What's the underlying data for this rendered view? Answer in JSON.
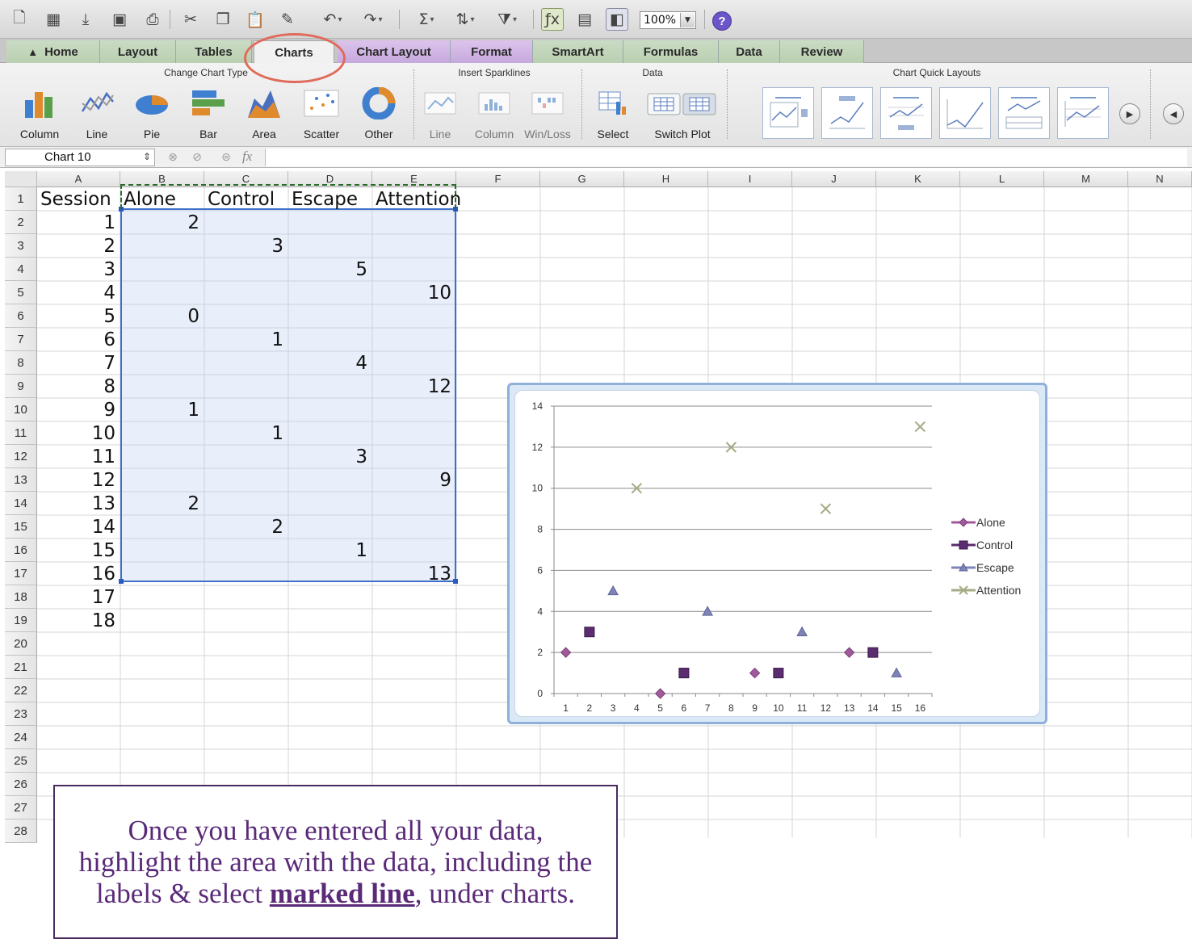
{
  "toolbar": {
    "zoom": "100%",
    "icons": [
      "new-icon",
      "gallery-icon",
      "open-icon",
      "save-icon",
      "print-icon",
      "cut-icon",
      "copy-icon",
      "paste-icon",
      "format-painter-icon",
      "undo-icon",
      "redo-icon",
      "autosum-icon",
      "sort-icon",
      "filter-icon",
      "function-icon",
      "toolbox-icon",
      "media-browser-icon",
      "help-icon"
    ]
  },
  "tabs": [
    "Home",
    "Layout",
    "Tables",
    "Charts",
    "Chart Layout",
    "Format",
    "SmartArt",
    "Formulas",
    "Data",
    "Review"
  ],
  "ribbon": {
    "groups": {
      "change_chart_type": "Change Chart Type",
      "insert_sparklines": "Insert Sparklines",
      "data": "Data",
      "chart_quick_layouts": "Chart Quick Layouts"
    },
    "chart_types": [
      "Column",
      "Line",
      "Pie",
      "Bar",
      "Area",
      "Scatter",
      "Other"
    ],
    "sparklines": [
      "Line",
      "Column",
      "Win/Loss"
    ],
    "data_buttons": [
      "Select",
      "Switch Plot"
    ]
  },
  "formula_bar": {
    "name_box": "Chart 10",
    "fx": "fx",
    "content": ""
  },
  "sheet": {
    "columns": [
      "A",
      "B",
      "C",
      "D",
      "E",
      "F",
      "G",
      "H",
      "I",
      "J",
      "K",
      "L",
      "M",
      "N"
    ],
    "rows": [
      "1",
      "2",
      "3",
      "4",
      "5",
      "6",
      "7",
      "8",
      "9",
      "10",
      "11",
      "12",
      "13",
      "14",
      "15",
      "16",
      "17",
      "18",
      "19",
      "20",
      "21",
      "22",
      "23",
      "24",
      "25",
      "26",
      "27",
      "28"
    ],
    "headers": [
      "Session",
      "Alone",
      "Control",
      "Escape",
      "Attention"
    ],
    "sessions": [
      "1",
      "2",
      "3",
      "4",
      "5",
      "6",
      "7",
      "8",
      "9",
      "10",
      "11",
      "12",
      "13",
      "14",
      "15",
      "16",
      "17",
      "18"
    ],
    "values": [
      {
        "col": "B",
        "row": 2,
        "value": "2"
      },
      {
        "col": "C",
        "row": 3,
        "value": "3"
      },
      {
        "col": "D",
        "row": 4,
        "value": "5"
      },
      {
        "col": "E",
        "row": 5,
        "value": "10"
      },
      {
        "col": "B",
        "row": 6,
        "value": "0"
      },
      {
        "col": "C",
        "row": 7,
        "value": "1"
      },
      {
        "col": "D",
        "row": 8,
        "value": "4"
      },
      {
        "col": "E",
        "row": 9,
        "value": "12"
      },
      {
        "col": "B",
        "row": 10,
        "value": "1"
      },
      {
        "col": "C",
        "row": 11,
        "value": "1"
      },
      {
        "col": "D",
        "row": 12,
        "value": "3"
      },
      {
        "col": "E",
        "row": 13,
        "value": "9"
      },
      {
        "col": "B",
        "row": 14,
        "value": "2"
      },
      {
        "col": "C",
        "row": 15,
        "value": "2"
      },
      {
        "col": "D",
        "row": 16,
        "value": "1"
      },
      {
        "col": "E",
        "row": 17,
        "value": "13"
      }
    ]
  },
  "chart_data": {
    "type": "scatter",
    "x": [
      1,
      2,
      3,
      4,
      5,
      6,
      7,
      8,
      9,
      10,
      11,
      12,
      13,
      14,
      15,
      16
    ],
    "xticks": [
      "1",
      "2",
      "3",
      "4",
      "5",
      "6",
      "7",
      "8",
      "9",
      "10",
      "11",
      "12",
      "13",
      "14",
      "15",
      "16"
    ],
    "yticks": [
      "0",
      "2",
      "4",
      "6",
      "8",
      "10",
      "12",
      "14"
    ],
    "ylim": [
      0,
      14
    ],
    "grid": true,
    "legend_position": "right",
    "series": [
      {
        "name": "Alone",
        "marker": "diamond",
        "color": "#a05a9a",
        "points": [
          [
            1,
            2
          ],
          [
            5,
            0
          ],
          [
            9,
            1
          ],
          [
            13,
            2
          ]
        ]
      },
      {
        "name": "Control",
        "marker": "square",
        "color": "#5b2c6f",
        "points": [
          [
            2,
            3
          ],
          [
            6,
            1
          ],
          [
            10,
            1
          ],
          [
            14,
            2
          ]
        ]
      },
      {
        "name": "Escape",
        "marker": "triangle",
        "color": "#7e84b8",
        "points": [
          [
            3,
            5
          ],
          [
            7,
            4
          ],
          [
            11,
            3
          ],
          [
            15,
            1
          ]
        ]
      },
      {
        "name": "Attention",
        "marker": "x",
        "color": "#a7ab85",
        "points": [
          [
            4,
            10
          ],
          [
            8,
            12
          ],
          [
            12,
            9
          ],
          [
            16,
            13
          ]
        ]
      }
    ]
  },
  "instruction": {
    "line1": "Once you have entered all your data,",
    "line2": "highlight the area with the data, including the",
    "line3_pre": "labels & select ",
    "line3_em": "marked line",
    "line3_post": ", under charts."
  }
}
